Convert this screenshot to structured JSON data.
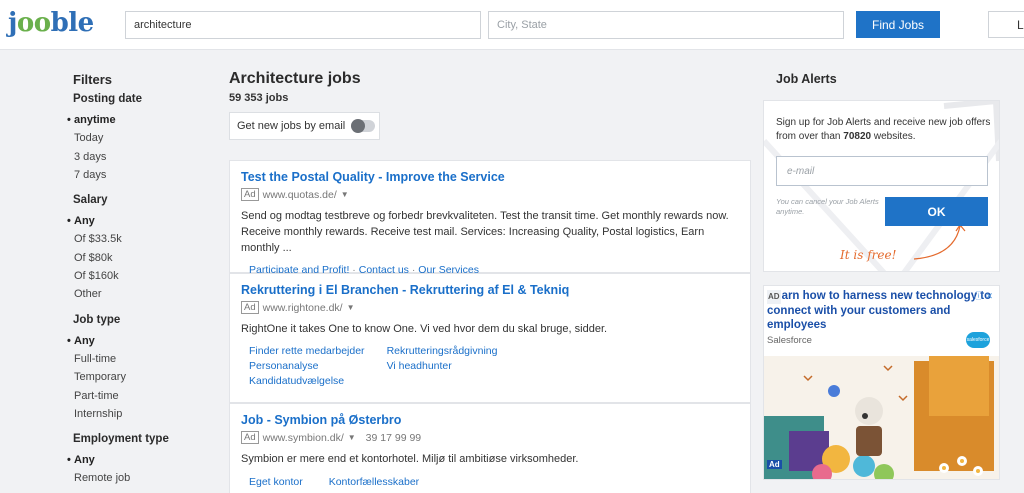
{
  "header": {
    "logo_text_start": "j",
    "logo_text_oo": "oo",
    "logo_text_end": "ble",
    "search_value": "architecture",
    "city_placeholder": "City, State",
    "find_label": "Find Jobs",
    "login_label": "L"
  },
  "filters": {
    "title": "Filters",
    "groups": [
      {
        "title": "Posting date",
        "options": [
          "anytime",
          "Today",
          "3 days",
          "7 days"
        ],
        "selected": "anytime"
      },
      {
        "title": "Salary",
        "options": [
          "Any",
          "Of $33.5k",
          "Of $80k",
          "Of $160k",
          "Other"
        ],
        "selected": "Any"
      },
      {
        "title": "Job type",
        "options": [
          "Any",
          "Full-time",
          "Temporary",
          "Part-time",
          "Internship"
        ],
        "selected": "Any"
      },
      {
        "title": "Employment type",
        "options": [
          "Any",
          "Remote job"
        ],
        "selected": "Any"
      }
    ]
  },
  "main": {
    "title": "Architecture jobs",
    "count": "59 353 jobs",
    "email_toggle_label": "Get new jobs by email",
    "email_toggle_on": false,
    "cards": [
      {
        "title": "Test the Postal Quality - Improve the Service",
        "ad": "Ad",
        "url": "www.quotas.de/",
        "desc": "Send og modtag testbreve og forbedr brevkvaliteten. Test the transit time. Get monthly rewards now. Receive monthly rewards. Receive test mail. Services: Increasing Quality, Postal logistics, Earn monthly ...",
        "links": [
          "Participate and Profit!",
          "Contact us",
          "Our Services"
        ]
      },
      {
        "title": "Rekruttering i El Branchen - Rekruttering af El & Tekniq",
        "ad": "Ad",
        "url": "www.rightone.dk/",
        "desc": "RightOne it takes One to know One. Vi ved hvor dem du skal bruge, sidder.",
        "links_col1": [
          "Finder rette medarbejder",
          "Personanalyse",
          "Kandidatudvælgelse"
        ],
        "links_col2": [
          "Rekrutteringsrådgivning",
          "Vi headhunter"
        ]
      },
      {
        "title": "Job - Symbion på Østerbro",
        "ad": "Ad",
        "url": "www.symbion.dk/",
        "phone": "39 17 99 99",
        "desc": "Symbion er mere end et kontorhotel. Miljø til ambitiøse virksomheder.",
        "links": [
          "Eget kontor",
          "Kontorfællesskaber"
        ]
      }
    ]
  },
  "alerts": {
    "title": "Job Alerts",
    "text_before": "Sign up for Job Alerts and receive new job offers from over than",
    "text_number": "70820",
    "text_after": "websites.",
    "email_placeholder": "e-mail",
    "cancel_note": "You can cancel your Job Alerts anytime.",
    "ok_label": "OK",
    "free_text": "It is free!"
  },
  "ad": {
    "tag": "AD",
    "headline": "arn how to harness new technology to connect with your customers and employees",
    "sponsor": "Salesforce",
    "badge_bottom": "Ad",
    "close_label": "ⓘ ✕",
    "logo_text": "salesforce"
  },
  "colors": {
    "brand_blue": "#1f73c7",
    "link_blue": "#1a6fc9",
    "logo_green": "#6ab04c",
    "accent_orange": "#e46a2d"
  }
}
